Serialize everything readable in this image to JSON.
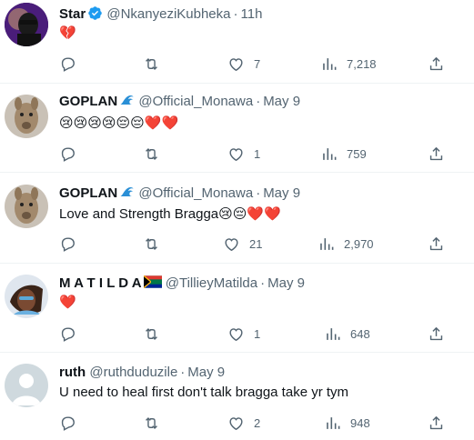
{
  "tweets": [
    {
      "name": "Star",
      "handle": "@NkanyeziKubheka",
      "time": "11h",
      "text": "💔",
      "verified": true,
      "likes": "7",
      "views": "7,218",
      "replies": "",
      "retweets": ""
    },
    {
      "name": "GOPLAN",
      "handle": "@Official_Monawa",
      "time": "May 9",
      "text": "😢😢😢😢😔😔❤️❤️",
      "likes": "1",
      "views": "759",
      "replies": "",
      "retweets": ""
    },
    {
      "name": "GOPLAN",
      "handle": "@Official_Monawa",
      "time": "May 9",
      "text": "Love and Strength Bragga😢😔❤️❤️",
      "likes": "21",
      "views": "2,970",
      "replies": "",
      "retweets": ""
    },
    {
      "name": "M A T I L D A",
      "handle": "@TillieyMatilda",
      "time": "May 9",
      "text": "❤️",
      "likes": "1",
      "views": "648",
      "replies": "",
      "retweets": ""
    },
    {
      "name": "ruth",
      "handle": "@ruthduduzile",
      "time": "May 9",
      "text": "U need to heal first don't talk bragga take yr tym",
      "likes": "2",
      "views": "948",
      "replies": "",
      "retweets": ""
    }
  ],
  "separator": "·",
  "icons": {
    "reply": "reply-icon",
    "retweet": "retweet-icon",
    "like": "heart-icon",
    "views": "views-icon",
    "share": "share-icon",
    "verified": "verified-badge-icon"
  },
  "colors": {
    "verified": "#1d9bf0",
    "secondary_text": "#536471"
  }
}
